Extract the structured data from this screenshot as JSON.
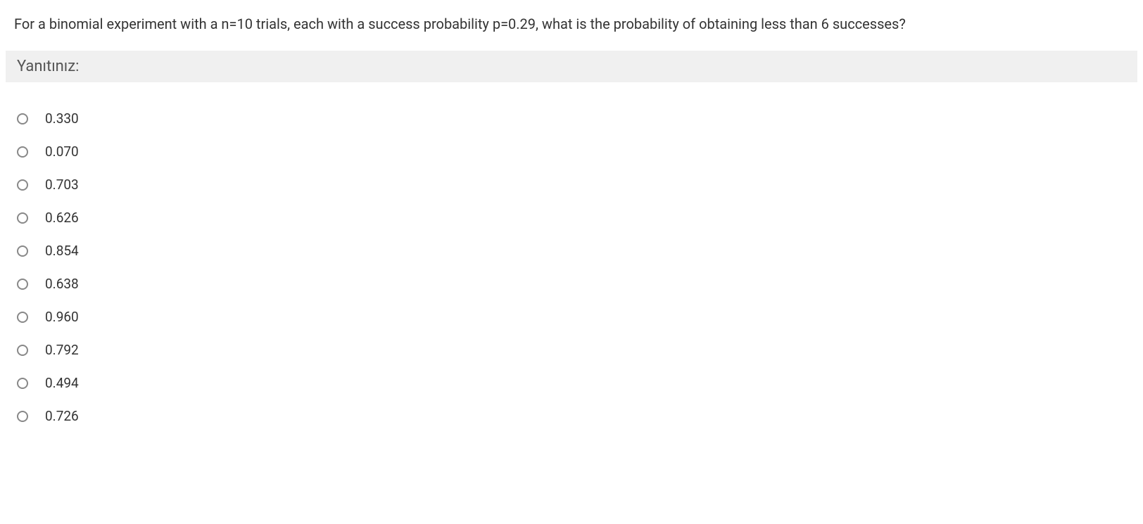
{
  "question": {
    "text": "For a binomial experiment with a n=10 trials, each with a success probability p=0.29, what is the probability of obtaining less than 6 successes?"
  },
  "answerSection": {
    "label": "Yanıtınız:"
  },
  "options": [
    {
      "label": "0.330"
    },
    {
      "label": "0.070"
    },
    {
      "label": "0.703"
    },
    {
      "label": "0.626"
    },
    {
      "label": "0.854"
    },
    {
      "label": "0.638"
    },
    {
      "label": "0.960"
    },
    {
      "label": "0.792"
    },
    {
      "label": "0.494"
    },
    {
      "label": "0.726"
    }
  ]
}
